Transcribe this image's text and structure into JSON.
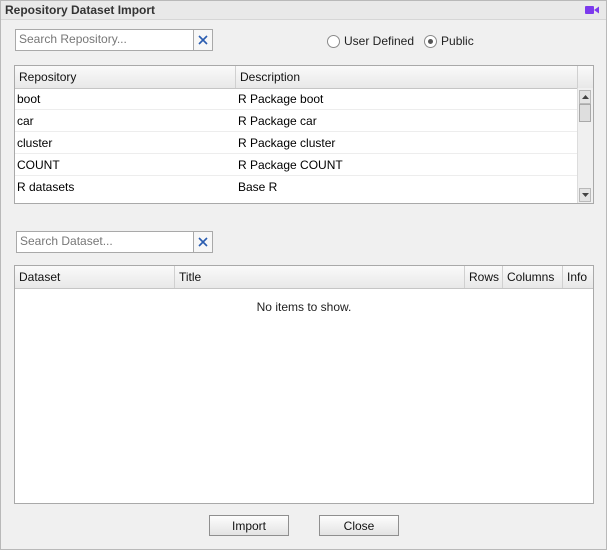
{
  "window": {
    "title": "Repository Dataset Import",
    "icon": "camera-icon",
    "accent": "#7c3aed"
  },
  "repo_search": {
    "placeholder": "Search Repository...",
    "value": ""
  },
  "source_options": {
    "user_defined": "User Defined",
    "public": "Public",
    "selected": "public"
  },
  "repo_table": {
    "columns": [
      "Repository",
      "Description"
    ],
    "rows": [
      {
        "repository": "boot",
        "description": "R Package boot"
      },
      {
        "repository": "car",
        "description": "R Package car"
      },
      {
        "repository": "cluster",
        "description": "R Package cluster"
      },
      {
        "repository": "COUNT",
        "description": "R Package COUNT"
      },
      {
        "repository": "R datasets",
        "description": "Base R"
      }
    ]
  },
  "dataset_search": {
    "placeholder": "Search Dataset...",
    "value": ""
  },
  "dataset_table": {
    "columns": [
      "Dataset",
      "Title",
      "Rows",
      "Columns",
      "Info"
    ],
    "empty_text": "No items to show."
  },
  "buttons": {
    "import": "Import",
    "close": "Close"
  }
}
